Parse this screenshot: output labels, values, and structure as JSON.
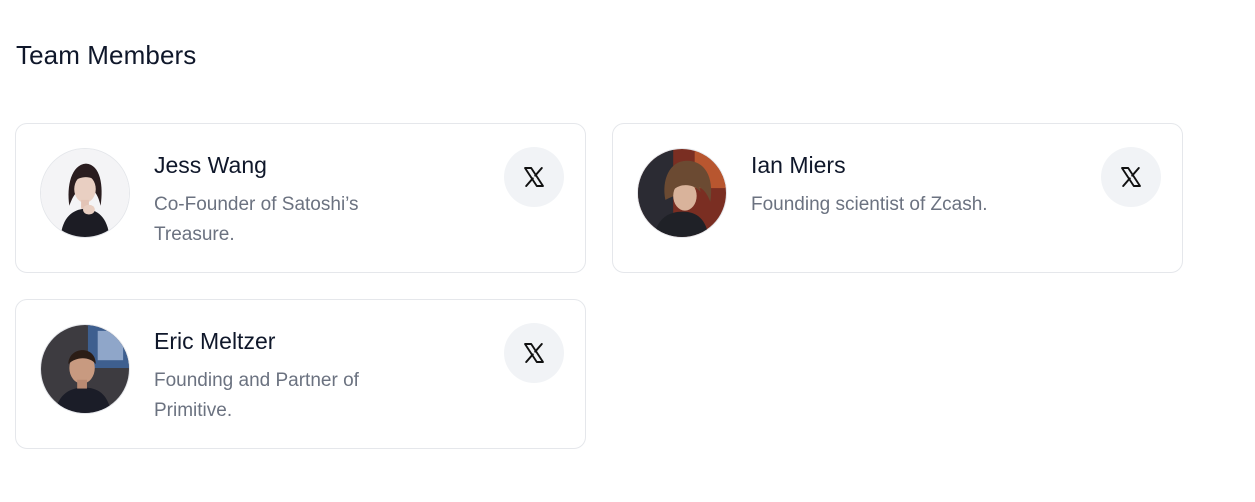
{
  "section": {
    "title": "Team Members"
  },
  "members": [
    {
      "name": "Jess Wang",
      "bio": "Co-Founder of Satoshi’s Treasure.",
      "social_icon": "x-logo-icon"
    },
    {
      "name": "Ian Miers",
      "bio": "Founding scientist of Zcash.",
      "social_icon": "x-logo-icon"
    },
    {
      "name": "Eric Meltzer",
      "bio": "Founding and Partner of Primitive.",
      "social_icon": "x-logo-icon"
    }
  ],
  "colors": {
    "text_primary": "#0f172a",
    "text_secondary": "#6b7280",
    "card_border": "#e5e7eb",
    "icon_button_bg": "#f1f3f6"
  }
}
